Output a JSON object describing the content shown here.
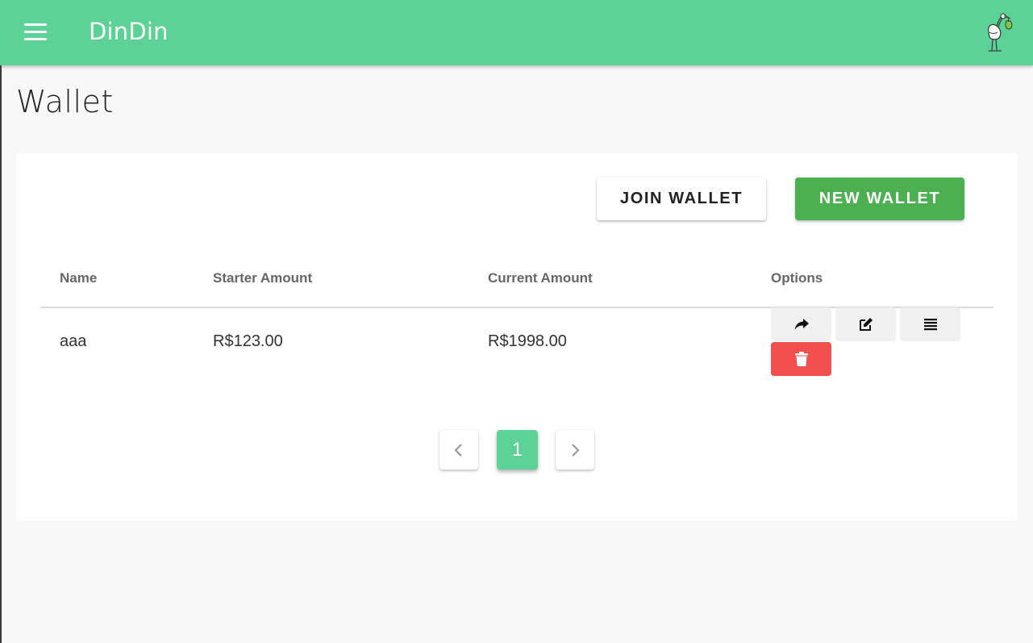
{
  "app": {
    "title": "DinDin",
    "brand_color": "#5cd296"
  },
  "page": {
    "title": "Wallet"
  },
  "actions": {
    "join_label": "JOIN WALLET",
    "new_label": "NEW WALLET",
    "new_color": "#4caf50"
  },
  "table": {
    "columns": [
      "Name",
      "Starter Amount",
      "Current Amount",
      "Options"
    ],
    "rows": [
      {
        "name": "aaa",
        "starter_amount": "R$123.00",
        "current_amount": "R$1998.00",
        "options": [
          "share-icon",
          "edit-icon",
          "list-icon",
          "trash-icon"
        ]
      }
    ]
  },
  "pagination": {
    "current_page": "1",
    "prev_icon": "chevron-left-icon",
    "next_icon": "chevron-right-icon"
  },
  "colors": {
    "delete": "#f44f4f"
  }
}
